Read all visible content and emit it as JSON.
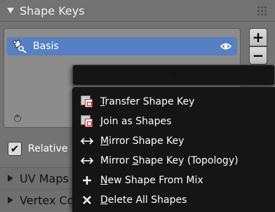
{
  "panel": {
    "title": "Shape Keys"
  },
  "shape_keys": {
    "items": [
      {
        "label": "Basis",
        "selected": true
      }
    ]
  },
  "side_buttons": {
    "add": "+",
    "remove": "−",
    "menu": "▼"
  },
  "relative": {
    "label": "Relative",
    "checked": true
  },
  "subpanels": [
    {
      "title": "UV Maps"
    },
    {
      "title": "Vertex Co"
    }
  ],
  "context_menu": {
    "items": [
      {
        "pre": "",
        "u": "T",
        "post": "ransfer Shape Key",
        "icon": "shape-key-icon"
      },
      {
        "pre": "",
        "u": "J",
        "post": "oin as Shapes",
        "icon": "shape-key-icon"
      },
      {
        "pre": "",
        "u": "M",
        "post": "irror Shape Key",
        "icon": "mirror-arrows-icon"
      },
      {
        "pre": "Mirror ",
        "u": "S",
        "post": "hape Key (Topology)",
        "icon": "mirror-arrows-icon"
      },
      {
        "pre": "",
        "u": "N",
        "post": "ew Shape From Mix",
        "icon": "plus-icon"
      },
      {
        "pre": "",
        "u": "D",
        "post": "elete All Shapes",
        "icon": "x-icon"
      }
    ]
  },
  "colors": {
    "selection": "#5680c2",
    "menu_bg": "#151515"
  }
}
